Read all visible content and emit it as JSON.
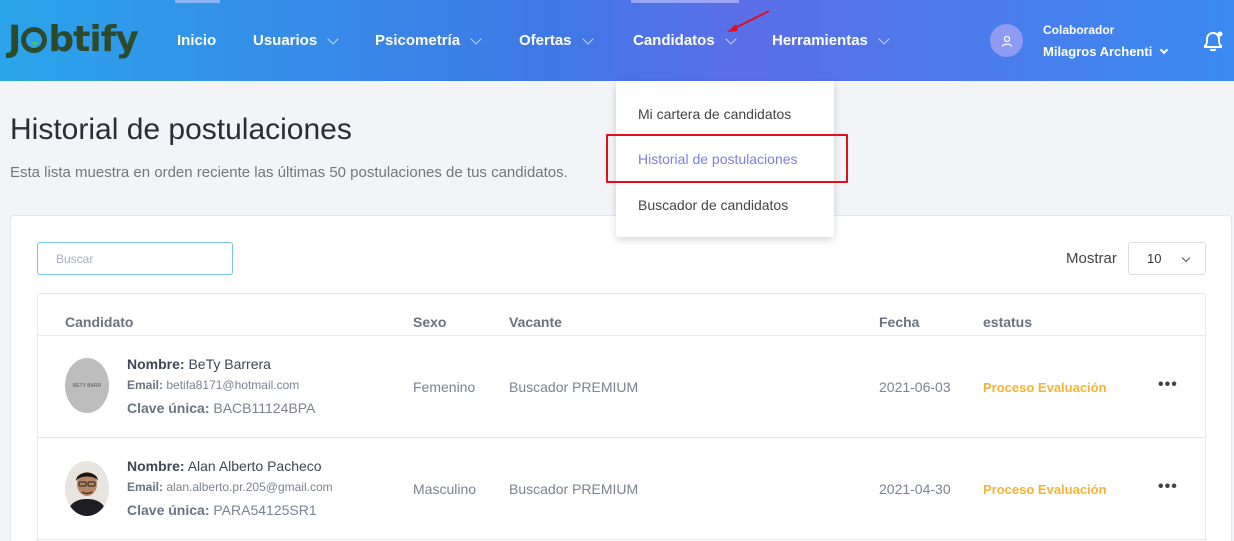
{
  "header": {
    "logo": "Jobtify",
    "nav": [
      {
        "label": "Inicio"
      },
      {
        "label": "Usuarios"
      },
      {
        "label": "Psicometría"
      },
      {
        "label": "Ofertas"
      },
      {
        "label": "Candidatos"
      },
      {
        "label": "Herramientas"
      }
    ],
    "user_role": "Colaborador",
    "user_name": "Milagros Archenti"
  },
  "dropdown": {
    "items": [
      {
        "label": "Mi cartera de candidatos"
      },
      {
        "label": "Historial de postulaciones"
      },
      {
        "label": "Buscador de candidatos"
      }
    ]
  },
  "page": {
    "title": "Historial de postulaciones",
    "subtitle": "Esta lista muestra en orden reciente las últimas 50 postulaciones de tus candidatos."
  },
  "controls": {
    "search_placeholder": "Buscar",
    "show_label": "Mostrar",
    "show_value": "10"
  },
  "table": {
    "columns": [
      "Candidato",
      "Sexo",
      "Vacante",
      "Fecha",
      "estatus"
    ],
    "labels": {
      "name": "Nombre:",
      "email": "Email:",
      "key": "Clave única:"
    },
    "rows": [
      {
        "avatar_text": "BETY BARR",
        "name": "BeTy Barrera",
        "email": "betifa8171@hotmail.com",
        "key": "BACB11124BPA",
        "sex": "Femenino",
        "vacancy": "Buscador PREMIUM",
        "date": "2021-06-03",
        "status": "Proceso Evaluación"
      },
      {
        "avatar_text": "",
        "name": "Alan Alberto Pacheco",
        "email": "alan.alberto.pr.205@gmail.com",
        "key": "PARA54125SR1",
        "sex": "Masculino",
        "vacancy": "Buscador PREMIUM",
        "date": "2021-04-30",
        "status": "Proceso Evaluación"
      }
    ],
    "row_menu": "•••"
  },
  "colors": {
    "status": "#f2b338",
    "highlight": "#e0101c",
    "accent": "#7c7fe0"
  }
}
